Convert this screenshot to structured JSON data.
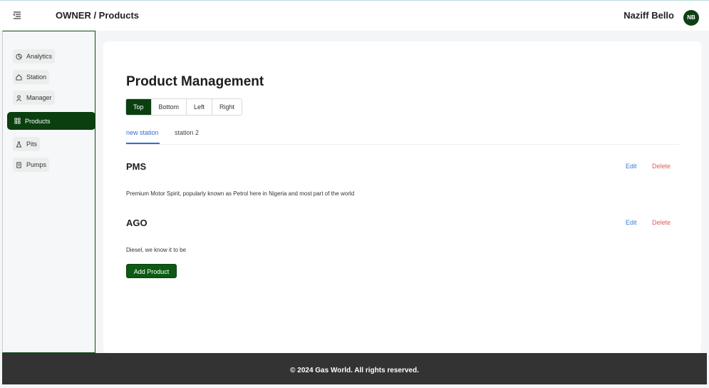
{
  "header": {
    "breadcrumb": "OWNER / Products",
    "user_name": "Naziff Bello",
    "avatar_initials": "NB"
  },
  "sidebar": {
    "items": [
      {
        "label": "Analytics",
        "icon": "pie-chart-icon"
      },
      {
        "label": "Station",
        "icon": "home-icon"
      },
      {
        "label": "Manager",
        "icon": "user-icon"
      },
      {
        "label": "Products",
        "icon": "grid-icon",
        "active": true
      },
      {
        "label": "Pits",
        "icon": "flask-icon"
      },
      {
        "label": "Pumps",
        "icon": "document-icon"
      }
    ]
  },
  "main": {
    "title": "Product Management",
    "position_options": [
      "Top",
      "Bottom",
      "Left",
      "Right"
    ],
    "selected_position": "Top",
    "tabs": [
      "new station",
      "station 2"
    ],
    "active_tab": "new station",
    "products": [
      {
        "name": "PMS",
        "description": "Premium Motor Spirit, popularly known as Petrol here in Nigeria and most part of the world",
        "edit_label": "Edit",
        "delete_label": "Delete"
      },
      {
        "name": "AGO",
        "description": "Diesel, we know it to be",
        "edit_label": "Edit",
        "delete_label": "Delete"
      }
    ],
    "add_button_label": "Add Product"
  },
  "footer": {
    "text": "© 2024 Gas World. All rights reserved."
  },
  "colors": {
    "brand_dark_green": "#0a3f10",
    "link_blue": "#2f6fd0",
    "delete_red": "#e05a5a",
    "footer_bg": "#333333"
  }
}
